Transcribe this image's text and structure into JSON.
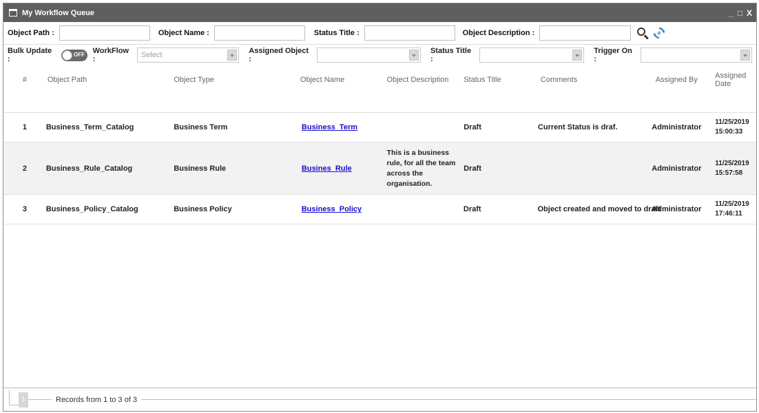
{
  "window": {
    "title": "My Workflow Queue",
    "controls": {
      "minimize": "_",
      "maximize": "□",
      "close": "X"
    }
  },
  "filters": {
    "object_path_label": "Object Path :",
    "object_name_label": "Object Name :",
    "status_title_label": "Status Title :",
    "object_description_label": "Object Description :",
    "search_icon": "search-icon",
    "refresh_icon": "refresh-icon"
  },
  "bulk": {
    "bulk_update_label": "Bulk Update :",
    "toggle_text": "OFF",
    "workflow_label": "WorkFlow :",
    "workflow_placeholder": "Select",
    "assigned_object_label": "Assigned Object :",
    "status_title_label": "Status Title :",
    "trigger_on_label": "Trigger On :"
  },
  "grid": {
    "columns": [
      "#",
      "Object Path",
      "Object Type",
      "Object Name",
      "Object Description",
      "Status Title",
      "Comments",
      "Assigned By",
      "Assigned Date"
    ],
    "rows": [
      {
        "num": "1",
        "path": "Business_Term_Catalog",
        "type": "Business Term",
        "name": "Business_Term",
        "description": "",
        "status": "Draft",
        "comments": "Current Status is draf.",
        "assigned_by": "Administrator",
        "date": "11/25/2019",
        "time": "15:00:33"
      },
      {
        "num": "2",
        "path": "Business_Rule_Catalog",
        "type": "Business Rule",
        "name": "Busines_Rule",
        "description": "This is a business rule, for all the team across the organisation.",
        "status": "Draft",
        "comments": "",
        "assigned_by": "Administrator",
        "date": "11/25/2019",
        "time": "15:57:58"
      },
      {
        "num": "3",
        "path": "Business_Policy_Catalog",
        "type": "Business Policy",
        "name": "Business_Policy",
        "description": "",
        "status": "Draft",
        "comments": "Object created and moved to draft",
        "assigned_by": "Administrator",
        "date": "11/25/2019",
        "time": "17:46:11"
      }
    ]
  },
  "footer": {
    "page": "1",
    "records": "Records from 1 to 3 of 3"
  },
  "colors": {
    "titlebar": "#5f5f5f",
    "link": "#1a0dcc",
    "alt_row": "#f2f2f2",
    "refresh_blue": "#3a8fd0"
  }
}
